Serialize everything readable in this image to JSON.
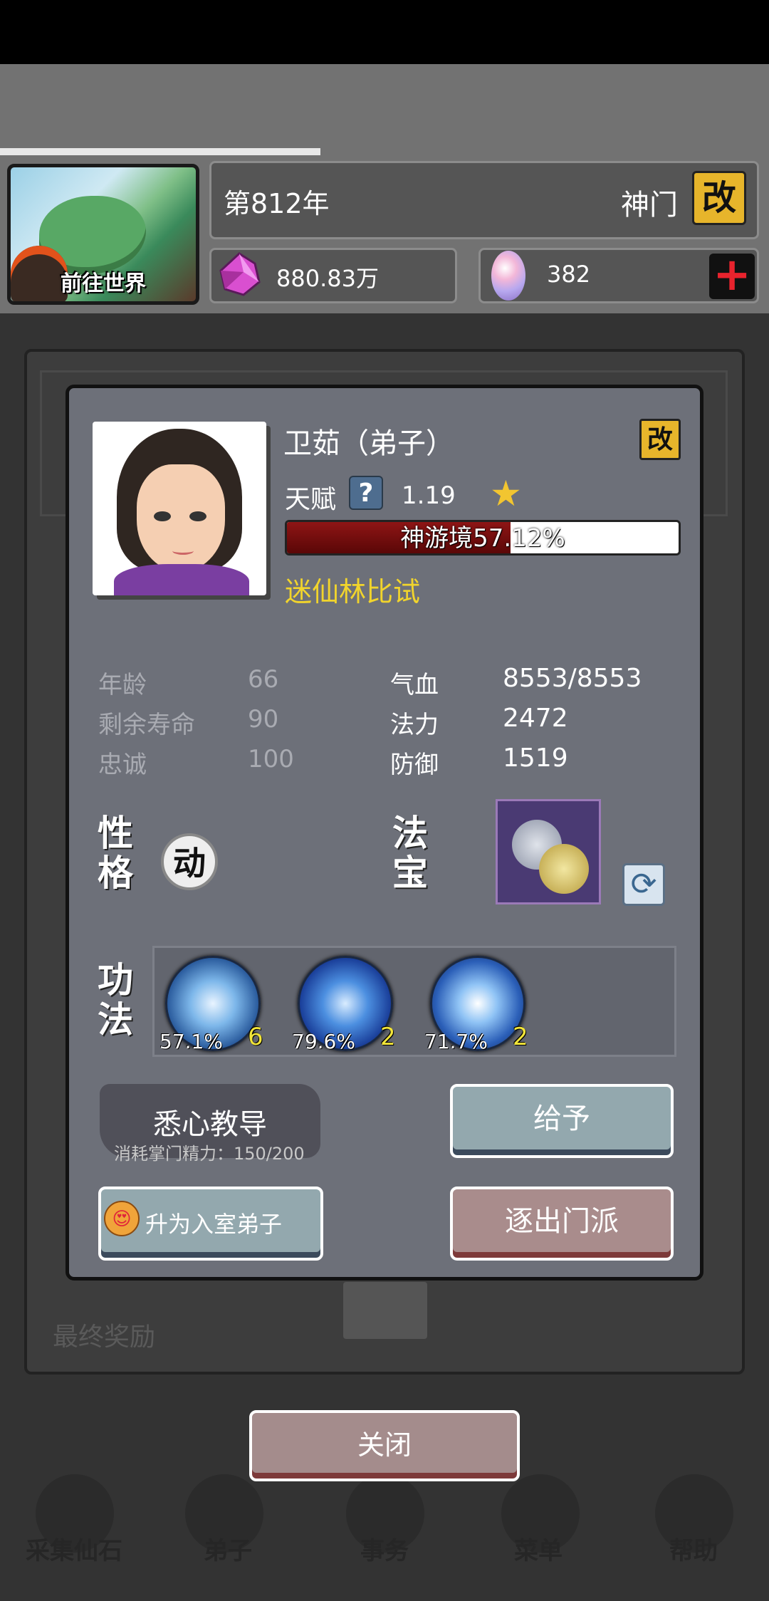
{
  "header": {
    "world_button_label": "前往世界",
    "year": "第812年",
    "sect_name": "神门",
    "rename_sect_label": "改",
    "spirit_stones": "880.83万",
    "eggs": "382",
    "add_label": "+"
  },
  "disciple": {
    "name": "卫茹（弟子）",
    "rename_label": "改",
    "talent_label": "天赋",
    "talent_help": "?",
    "talent_value": "1.19",
    "talent_star": "★",
    "realm_text": "神游境57.12%",
    "realm_progress": 0.5712,
    "event": "迷仙林比试",
    "stats_left": [
      {
        "label": "年龄",
        "value": "66"
      },
      {
        "label": "剩余寿命",
        "value": "90"
      },
      {
        "label": "忠诚",
        "value": "100"
      }
    ],
    "stats_right": [
      {
        "label": "气血",
        "value": "8553/8553"
      },
      {
        "label": "法力",
        "value": "2472"
      },
      {
        "label": "防御",
        "value": "1519"
      }
    ],
    "personality_label_1": "性",
    "personality_label_2": "格",
    "personality_value": "动",
    "treasure_label_1": "法",
    "treasure_label_2": "宝",
    "skills_label_1": "功",
    "skills_label_2": "法",
    "skills": [
      {
        "percent": "57.1%",
        "level": "6"
      },
      {
        "percent": "79.6%",
        "level": "2"
      },
      {
        "percent": "71.7%",
        "level": "2"
      }
    ]
  },
  "actions": {
    "teach_label": "悉心教导",
    "teach_cost": "消耗掌门精力：150/200",
    "give_label": "给予",
    "promote_label": "升为入室弟子",
    "promote_icon": "😍",
    "expel_label": "逐出门派",
    "close_label": "关闭"
  },
  "background": {
    "final_reward": "最终奖励",
    "nav": [
      "采集仙石",
      "弟子",
      "事务",
      "菜单",
      "帮助"
    ]
  },
  "colors": {
    "accent_yellow": "#e7b52b",
    "realm_fill": "#8e1515",
    "event_text": "#f1d42c",
    "dialog_bg": "#6d7079"
  }
}
